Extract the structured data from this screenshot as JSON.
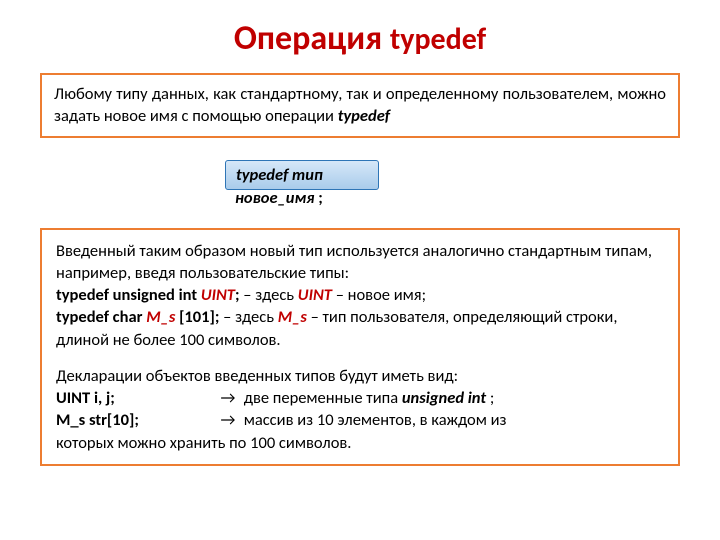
{
  "title_main": "Операция ",
  "title_code": "typedef",
  "intro_part1": "Любому типу данных, как стандартному, так и определенному пользователем, можно задать новое имя с помощью операции ",
  "intro_kw": "typedef",
  "syntax_kw": "typedef",
  "syntax_type": "   тип",
  "syntax_name": "новое_имя",
  "syntax_semi": " ;",
  "d1": "Введенный таким образом новый тип используется аналогично стандартным типам, например, введя пользовательские типы:",
  "d2a": "typedef unsigned int ",
  "d2b": "UINT",
  "d2c": "; ",
  "d2d": "   – здесь ",
  "d2e": "UINT",
  "d2f": " – новое имя;",
  "d3a": "typedef char ",
  "d3b": "M_s",
  "d3c": " [101]; ",
  "d3d": "– здесь ",
  "d3e": "M_s",
  "d3f": " – тип пользователя, определяющий строки, длиной не более 100 символов.",
  "d4": "Декларации объектов введенных типов будут иметь вид:",
  "d5a": "UINT   i, j;",
  "d5arrow": "→",
  "d5b": "   две переменные типа ",
  "d5c": "unsigned int",
  "d5d": " ;",
  "d6a": "M_s    str[10];",
  "d6arrow": "→",
  "d6b": "    массив из 10 элементов, в каждом из",
  "d7": "которых можно хранить по 100 символов."
}
